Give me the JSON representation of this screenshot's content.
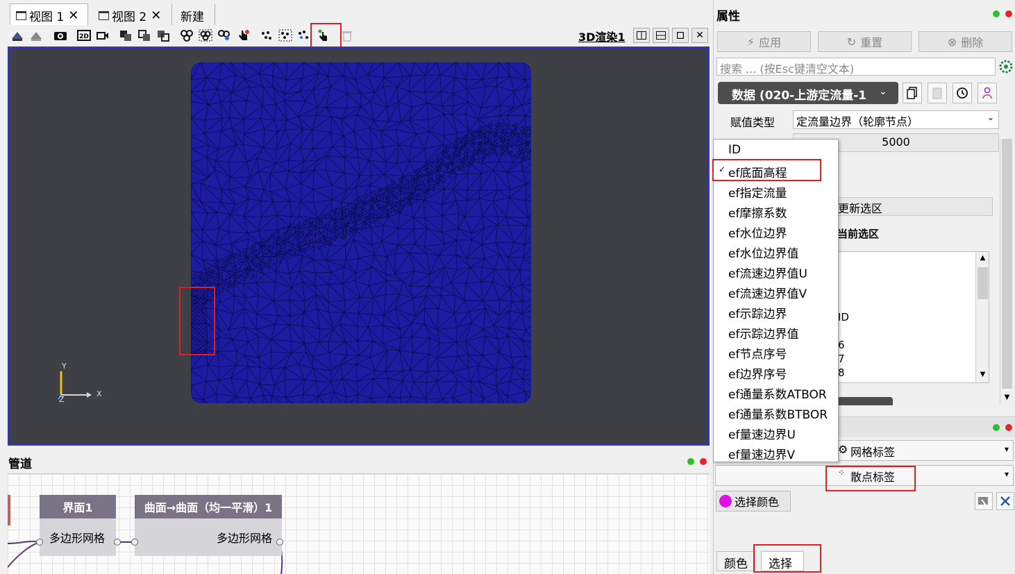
{
  "tabs": [
    {
      "label": "视图 1",
      "active": true
    },
    {
      "label": "视图 2",
      "active": false
    },
    {
      "label": "新建",
      "active": false
    }
  ],
  "toolbar": {
    "view_title": "3D渲染1",
    "icons": [
      "reset-camera-icon",
      "zoom-data-icon",
      "screenshot-icon",
      "2d-mode-icon",
      "record-icon",
      "select-cells-icon",
      "select-points-icon",
      "select-block-icon",
      "interactive-select-icon",
      "select-multi-icon",
      "select-polygon-icon",
      "hover-cells-icon",
      "hover-hand-icon",
      "scatter-points-icon",
      "grid-select-icon",
      "points-hand-icon",
      "pick-point-icon",
      "delete-icon"
    ]
  },
  "axes": {
    "y": "Y",
    "x": "X",
    "z": "Z"
  },
  "pipeline": {
    "title": "管道",
    "nodes": [
      {
        "title": "界面1",
        "port": "多边形网格"
      },
      {
        "title": "曲面→曲面（均一平滑）1",
        "port": "多边形网格"
      }
    ]
  },
  "properties": {
    "title": "属性",
    "apply_label": "应用",
    "reset_label": "重置",
    "delete_label": "删除",
    "search_placeholder": "搜索 ... (按Esc键清空文本)",
    "data_combo": "数据 (020-上游定流量-1",
    "assign_type_label": "赋值类型",
    "assign_type_value": "定流量边界（轮廓节点）",
    "value_field": "5000",
    "update_selection": "更新选区",
    "current_selection": "当前选区",
    "list_items": [
      "ID",
      "6",
      "7",
      "8"
    ],
    "section2": {
      "mesh_label": "网格标签",
      "scatter_label": "散点标签",
      "select_color": "选择颜色"
    },
    "bottom_tabs": [
      "颜色",
      "选择"
    ]
  },
  "dropdown": {
    "items": [
      "ID",
      "ef底面高程",
      "ef指定流量",
      "ef摩擦系数",
      "ef水位边界",
      "ef水位边界值",
      "ef流速边界值U",
      "ef流速边界值V",
      "ef示踪边界",
      "ef示踪边界值",
      "ef节点序号",
      "ef边界序号",
      "ef通量系数ATBOR",
      "ef通量系数BTBOR",
      "ef量速边界U",
      "ef量速边界V"
    ],
    "checked_index": 1
  },
  "colors": {
    "mesh": "#1c1ca0",
    "viewport_bg": "#3f3f46",
    "highlight": "#e02020",
    "node_header": "#7a7285",
    "select_color": "#e010e0"
  }
}
